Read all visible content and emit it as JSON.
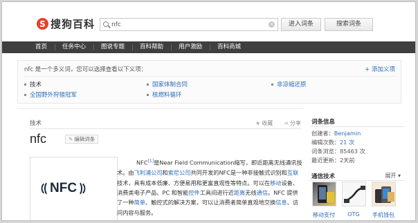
{
  "header": {
    "logo_mark": "S",
    "logo_text": "搜狗百科",
    "search_value": "nfc",
    "clear_icon_glyph": "×",
    "enter_button": "进入词条",
    "search_button": "搜索词条"
  },
  "nav": {
    "items": [
      "首页",
      "任务中心",
      "图说专题",
      "百科帮助",
      "用户激励",
      "百科商城"
    ]
  },
  "disambiguation": {
    "title": "nfc 是一个多义词，您可以选择查看以下义项：",
    "add_label": "+ 添加义项",
    "items": [
      {
        "label": "技术",
        "current": true
      },
      {
        "label": "国家体制合同"
      },
      {
        "label": "非凉缩还原"
      },
      {
        "label": "全国野外狩猎冠军"
      },
      {
        "label": "核燃料循环"
      }
    ]
  },
  "main": {
    "category": "技术",
    "collect_label": "收藏",
    "share_label": "分享",
    "title": "nfc",
    "edit_label": "编辑词条",
    "image_text": "NFC",
    "paragraph": {
      "p1": "NFC",
      "p2": "[1]",
      "p3": "是Near Field Communication缩写，即近距离无线通讯技术。由",
      "p4": "飞利浦公司",
      "p5": "和",
      "p6": "索尼公司",
      "p7": "共同开发的NFC是一种非接触式识别和",
      "p8": "互联",
      "p9": "技术，具有成本低廉、方便易用和更富直观性等特点。可以在",
      "p10": "移动",
      "p11": "设备、消费类电子产品、PC 和智能",
      "p12": "控件",
      "p13": "工具间进行近",
      "p14": "距离",
      "p15": "无线",
      "p16": "通信",
      "p17": "。NFC 提供了一种",
      "p18": "简单",
      "p19": "、触控式的解决方案，可以让消费者简单直观地交换",
      "p20": "信息",
      "p21": "、访问内容与服务。"
    }
  },
  "sidebar": {
    "info_title": "词条信息",
    "creator_label": "创建者：",
    "creator_value": "Benjamin",
    "edit_count_label": "编辑次数：",
    "edit_count_value": "21 次",
    "views_label": "词条浏览：",
    "views_value": "85463 次",
    "updated_label": "最近更新：",
    "updated_value": "2天前",
    "related_title": "通信技术",
    "expand_label": "展开",
    "related": [
      "移动支付",
      "OTG",
      "手机钱包"
    ]
  },
  "colors": {
    "brand_red": "#e8412c",
    "nav_bg": "#3f3f3f",
    "link_blue": "#2c6cb7"
  }
}
